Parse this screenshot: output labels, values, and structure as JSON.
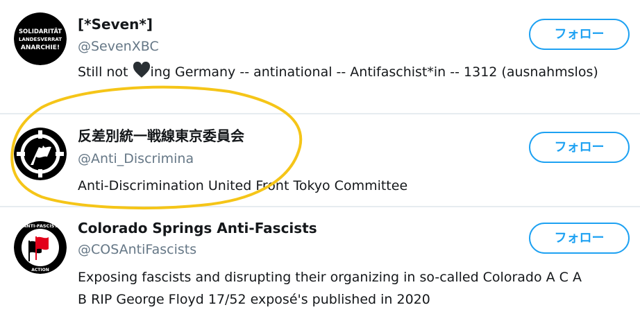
{
  "follow_label": "フォロー",
  "users": [
    {
      "name": "[*Seven*]",
      "handle": "@SevenXBC",
      "bio_before_heart": "Still not ",
      "bio_after_heart": "ing Germany -- antinational -- Antifaschist*in -- 1312 (ausnahmslos)",
      "avatar": {
        "lines": [
          "SOLIDARITÄT",
          "LANDESVERRAT",
          "ANARCHIE!"
        ],
        "background": "#000000"
      }
    },
    {
      "name": "反差別統一戦線東京委員会",
      "handle": "@Anti_Discrimina",
      "bio": "Anti-Discrimination United Front Tokyo Committee",
      "avatar": {
        "icon": "antifa-crosshair-flag-icon",
        "background": "#000000"
      }
    },
    {
      "name": "Colorado Springs Anti-Fascists",
      "handle": "@COSAntiFascists",
      "bio_line1": "Exposing fascists and disrupting their organizing in so-called Colorado A C A",
      "bio_line2": "B RIP George Floyd 17/52 exposé's published in 2020",
      "avatar": {
        "top_text": "ANTI-FASCIST",
        "bottom_text": "ACTION",
        "flag_colors": [
          "#e2001a",
          "#000000"
        ]
      }
    }
  ],
  "colors": {
    "accent": "#1da1f2",
    "handle": "#657786",
    "divider": "#e6ecf0",
    "highlight_circle": "#f5c518"
  }
}
